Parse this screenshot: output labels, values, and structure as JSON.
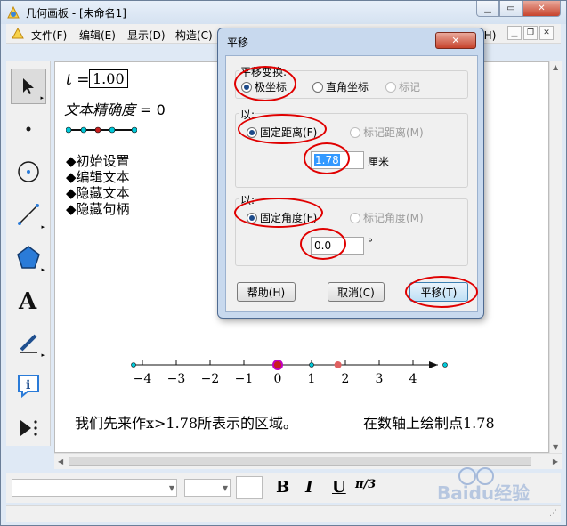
{
  "window": {
    "title": "几何画板 - [未命名1]"
  },
  "menu": {
    "items": [
      {
        "label": "文件(F)"
      },
      {
        "label": "编辑(E)"
      },
      {
        "label": "显示(D)"
      },
      {
        "label": "构造(C)"
      },
      {
        "label": "帮助(H)"
      }
    ]
  },
  "toolbox": {
    "tools": [
      "arrow-select-icon",
      "point-icon",
      "compass-icon",
      "straightedge-icon",
      "polygon-icon",
      "text-icon",
      "marker-icon",
      "info-icon",
      "custom-tool-icon"
    ]
  },
  "canvas": {
    "param_name": "t",
    "param_eq": "=",
    "param_value": "1.00",
    "precision_label": "文本精确度",
    "precision_eq": "=",
    "precision_value": "0",
    "buttons": [
      "◆初始设置",
      "◆编辑文本",
      "◆隐藏文本",
      "◆隐藏句柄"
    ],
    "axis": {
      "ticks": [
        "−4",
        "−3",
        "−2",
        "−1",
        "0",
        "1",
        "2",
        "3",
        "4"
      ],
      "tick_values": [
        -4,
        -3,
        -2,
        -1,
        0,
        1,
        2,
        3,
        4
      ],
      "marked_point": 1.78
    },
    "caption_left": "我们先来作x>1.78所表示的区域。",
    "caption_right": "在数轴上绘制点1.78"
  },
  "formatbar": {
    "bold": "B",
    "italic": "I",
    "underline": "U",
    "symbol": "π/3"
  },
  "dialog": {
    "title": "平移",
    "close": "✕",
    "group1": {
      "label": "平移变换:",
      "options": [
        {
          "label": "极坐标",
          "checked": true,
          "enabled": true
        },
        {
          "label": "直角坐标",
          "checked": false,
          "enabled": true
        },
        {
          "label": "标记",
          "checked": false,
          "enabled": false
        }
      ]
    },
    "group2": {
      "label": "以:",
      "options": [
        {
          "label": "固定距离(F)",
          "checked": true,
          "enabled": true
        },
        {
          "label": "标记距离(M)",
          "checked": false,
          "enabled": false
        }
      ],
      "value": "1.78",
      "unit": "厘米"
    },
    "group3": {
      "label": "以:",
      "options": [
        {
          "label": "固定角度(F)",
          "checked": true,
          "enabled": true
        },
        {
          "label": "标记角度(M)",
          "checked": false,
          "enabled": false
        }
      ],
      "value": "0.0",
      "unit": "°"
    },
    "buttons": {
      "help": "帮助(H)",
      "cancel": "取消(C)",
      "ok": "平移(T)"
    }
  },
  "colors": {
    "annotation": "#e00000",
    "slider_point": "#00c8d8",
    "slider_handle": "#c81e1e",
    "axis_origin": "#c000c0",
    "axis_marked": "#e06060"
  },
  "watermark": "Baidu经验"
}
